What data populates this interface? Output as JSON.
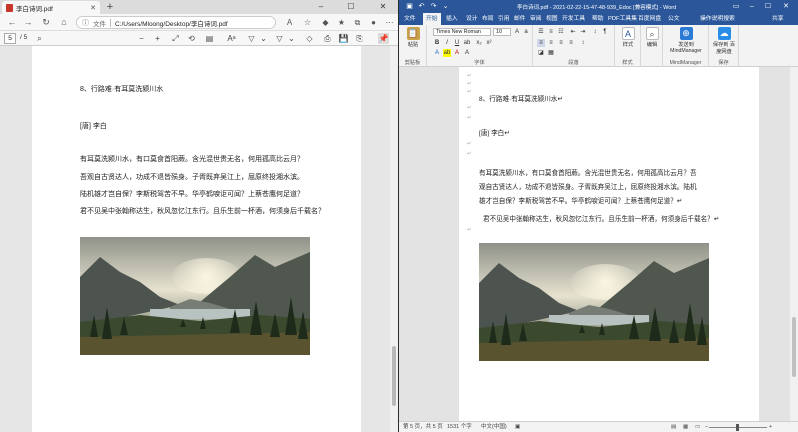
{
  "pdf_viewer": {
    "tab_title": "李白诗词.pdf",
    "address_label": "文件",
    "url": "C:/Users/Mloong/Desktop/李白诗词.pdf",
    "page_current": "5",
    "page_total": "/ 5",
    "content": {
      "heading": "8、行路难·有耳莫洗颍川水",
      "author": "[唐] 李白",
      "lines": [
        "有耳莫洗颍川水，有口莫食首阳蕨。含光混世贵无名，何用孤高比云月？",
        "吾观自古贤达人，功成不退皆殒身。子胥既弃吴江上，屈原终投湘水滨。",
        "陆机雄才岂自保？李斯税驾苦不早。华亭鹤唳讵可闻？上蔡苍鹰何足道？",
        "君不见吴中张翰称达生，秋风忽忆江东行。且乐生前一杯酒，何须身后千载名？"
      ]
    }
  },
  "word": {
    "doc_title": "李白诗词.pdf - 2021-02-22-15-47-48-939_Edoc [兼容模式] - Word",
    "share_label": "共享",
    "tabs": [
      "文件",
      "开始",
      "插入",
      "设计",
      "布局",
      "引用",
      "邮件",
      "审阅",
      "视图",
      "开发工具",
      "帮助",
      "PDF工具集",
      "百度网盘",
      "公文",
      "操作说明搜索"
    ],
    "active_tab": "开始",
    "ribbon": {
      "paste": "粘贴",
      "clipboard": "剪贴板",
      "font_name": "Times New Roman",
      "font_size": "10",
      "font_group": "字体",
      "paragraph_group": "段落",
      "styles": "样式",
      "styles_group": "样式",
      "editing": "编辑",
      "mindmanager_btn": "发送到 MindManager",
      "mindmanager_group": "MindManager",
      "save_baidu": "保存到 百度网盘",
      "save_group": "保存"
    },
    "content": {
      "heading": "8、行路难·有耳莫洗颍川水↵",
      "author": "[唐] 李白↵",
      "lines": [
        "有耳莫洗颍川水，有口莫食首阳蕨。含光混世贵无名，何用孤高比云月？吾",
        "观自古贤达人，功成不退皆殒身。子胥既弃吴江上，屈原终投湘水滨。陆机",
        "雄才岂自保？李斯税驾苦不早。华亭鹤唳讵可闻？上蔡苍鹰何足道？↵",
        "君不见吴中张翰称达生，秋风忽忆江东行。且乐生前一杯酒，何须身后千载名？↵"
      ]
    },
    "status": {
      "page": "第 5 页，共 5 页",
      "words": "1531 个字",
      "lang": "中文(中国)"
    }
  }
}
